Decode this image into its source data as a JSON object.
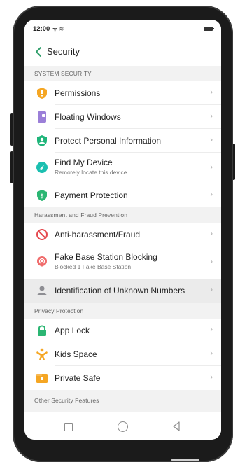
{
  "status_bar": {
    "time": "12:00",
    "signal": "ᯤ ≋",
    "battery_icon": "battery-icon"
  },
  "header": {
    "title": "Security",
    "back_icon": "back-chevron-icon",
    "accent": "#2e9e6a"
  },
  "sections": {
    "system": "SYSTEM SECURITY",
    "harassment": "Harassment and Fraud Prevention",
    "privacy": "Privacy Protection",
    "other": "Other Security Features"
  },
  "rows": [
    {
      "label": "Permissions",
      "icon": "shield-permissions-icon"
    },
    {
      "label": "Floating Windows",
      "icon": "floating-windows-icon"
    },
    {
      "label": "Protect Personal Information",
      "icon": "user-shield-icon"
    },
    {
      "label": "Find My Device",
      "subtitle": "Remotely locate this device",
      "icon": "find-device-icon"
    },
    {
      "label": "Payment Protection",
      "icon": "payment-shield-icon"
    },
    {
      "label": "Anti-harassment/Fraud",
      "icon": "block-icon"
    },
    {
      "label": "Fake Base Station Blocking",
      "subtitle": "Blocked 1 Fake Base Station",
      "icon": "base-station-icon"
    },
    {
      "label": "Identification of Unknown Numbers",
      "icon": "unknown-caller-icon",
      "highlighted": true
    },
    {
      "label": "App Lock",
      "icon": "lock-icon"
    },
    {
      "label": "Kids Space",
      "icon": "kids-icon"
    },
    {
      "label": "Private Safe",
      "icon": "safe-icon"
    }
  ],
  "chevron": "›",
  "nav_bar": {
    "recent": "recent-apps-icon",
    "home": "home-icon",
    "back": "back-icon"
  }
}
